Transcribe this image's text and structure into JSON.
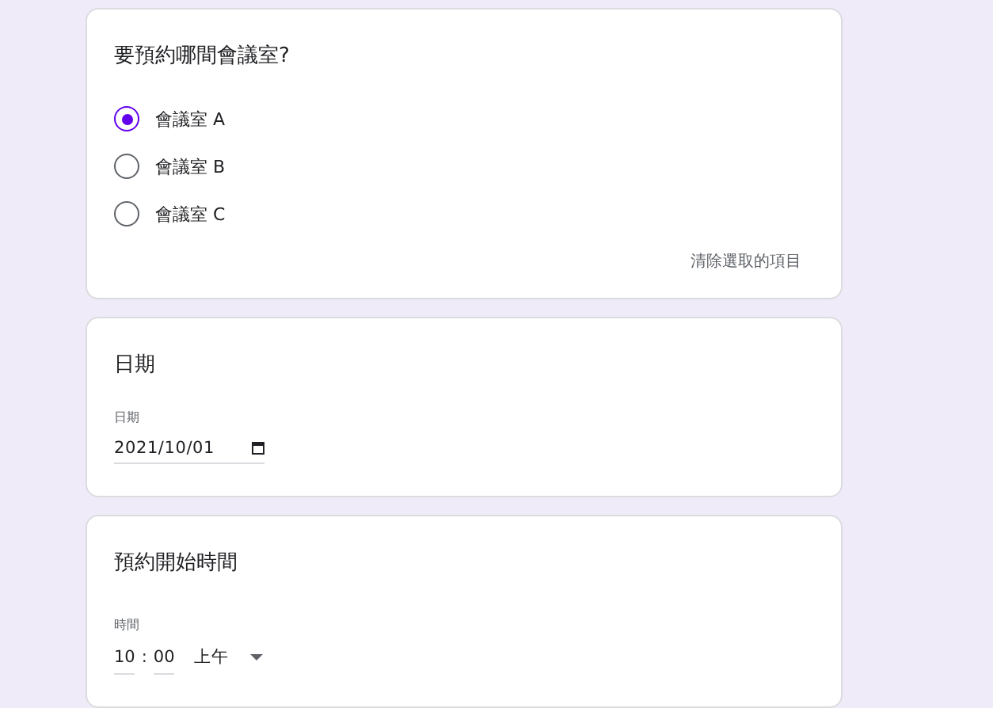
{
  "room_question": {
    "title": "要預約哪間會議室?",
    "options": [
      {
        "label": "會議室 A",
        "selected": true
      },
      {
        "label": "會議室 B",
        "selected": false
      },
      {
        "label": "會議室 C",
        "selected": false
      }
    ],
    "clear_link": "清除選取的項目"
  },
  "date_question": {
    "title": "日期",
    "field_label": "日期",
    "value": "2021/10/01"
  },
  "time_question": {
    "title": "預約開始時間",
    "field_label": "時間",
    "hour": "10",
    "separator": ":",
    "minute": "00",
    "period": "上午"
  }
}
